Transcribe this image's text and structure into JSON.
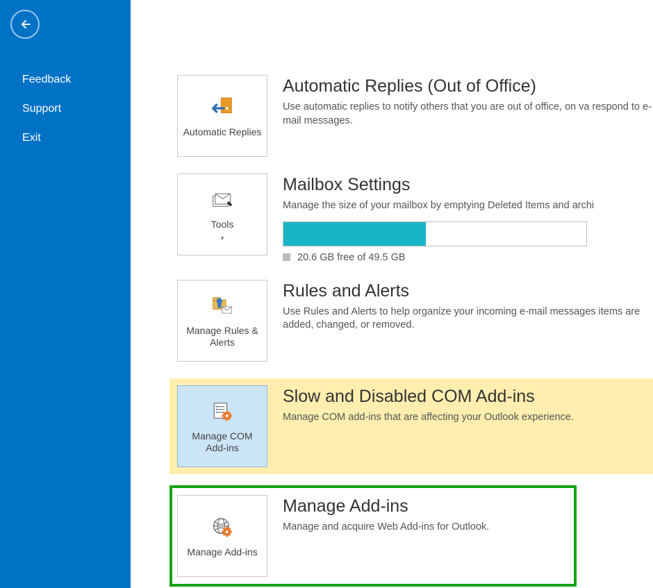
{
  "account_line": "",
  "sidebar": {
    "items": [
      "Feedback",
      "Support",
      "Exit"
    ]
  },
  "tiles": {
    "auto_replies": {
      "label": "Automatic Replies",
      "title": "Automatic Replies (Out of Office)",
      "desc": "Use automatic replies to notify others that you are out of office, on va\nrespond to e-mail messages."
    },
    "tools": {
      "label": "Tools",
      "title": "Mailbox Settings",
      "desc": "Manage the size of your mailbox by emptying Deleted Items and archi",
      "storage_free": "20.6 GB free of 49.5 GB",
      "fill_percent": 47
    },
    "rules": {
      "label": "Manage Rules & Alerts",
      "title": "Rules and Alerts",
      "desc": "Use Rules and Alerts to help organize your incoming e-mail messages\nitems are added, changed, or removed."
    },
    "com_addins": {
      "label": "Manage COM Add-ins",
      "title": "Slow and Disabled COM Add-ins",
      "desc": "Manage COM add-ins that are affecting your Outlook experience."
    },
    "manage_addins": {
      "label": "Manage Add-ins",
      "title": "Manage Add-ins",
      "desc": "Manage and acquire Web Add-ins for Outlook."
    }
  }
}
